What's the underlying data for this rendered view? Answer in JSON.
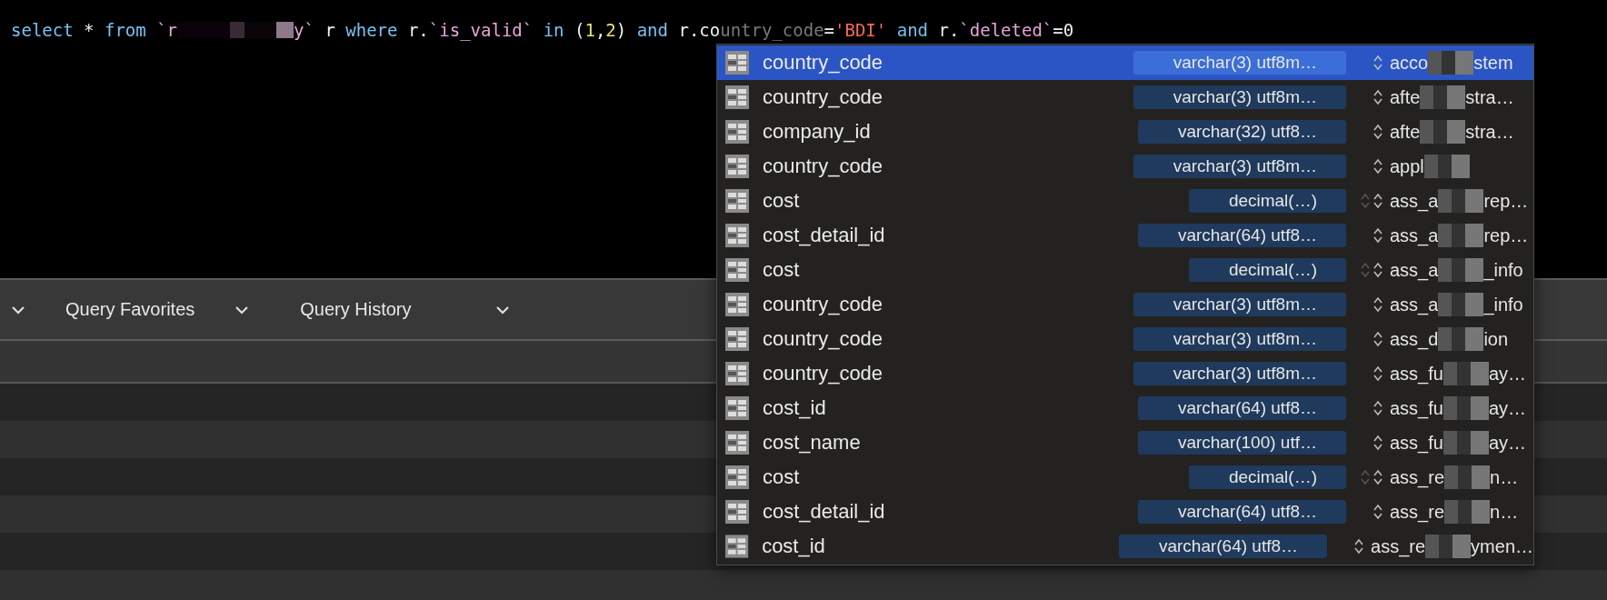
{
  "editor": {
    "tokens": [
      {
        "kind": "keyword",
        "text": "select"
      },
      {
        "kind": "plain",
        "text": " * "
      },
      {
        "kind": "keyword",
        "text": "from "
      },
      {
        "kind": "ident",
        "text": "`r"
      },
      {
        "kind": "redacted"
      },
      {
        "kind": "ident",
        "text": "y`"
      },
      {
        "kind": "plain",
        "text": " r "
      },
      {
        "kind": "keyword",
        "text": "where"
      },
      {
        "kind": "plain",
        "text": " r."
      },
      {
        "kind": "ident",
        "text": "`is_valid`"
      },
      {
        "kind": "keyword",
        "text": " in"
      },
      {
        "kind": "plain",
        "text": " ("
      },
      {
        "kind": "number",
        "text": "1"
      },
      {
        "kind": "plain",
        "text": ","
      },
      {
        "kind": "number",
        "text": "2"
      },
      {
        "kind": "plain",
        "text": ") "
      },
      {
        "kind": "keyword",
        "text": "and"
      },
      {
        "kind": "plain",
        "text": " r.co"
      },
      {
        "kind": "ghost",
        "text": "untry_code"
      },
      {
        "kind": "plain",
        "text": "="
      },
      {
        "kind": "string",
        "text": "'BDI'"
      },
      {
        "kind": "keyword",
        "text": " and"
      },
      {
        "kind": "plain",
        "text": " r."
      },
      {
        "kind": "ident",
        "text": "`deleted`"
      },
      {
        "kind": "plain",
        "text": "=0"
      }
    ]
  },
  "toolbar": {
    "items": [
      {
        "label": "Query Favorites"
      },
      {
        "label": "Query History"
      }
    ]
  },
  "completions": [
    {
      "name": "country_code",
      "type": "varchar(3) utf8m…",
      "table_start": "acco",
      "table_end": "stem",
      "selected": true,
      "dual_chevron": false
    },
    {
      "name": "country_code",
      "type": "varchar(3) utf8m…",
      "table_start": "afte",
      "table_end": "stra…",
      "selected": false,
      "dual_chevron": false
    },
    {
      "name": "company_id",
      "type": "varchar(32) utf8…",
      "table_start": "afte",
      "table_end": "stra…",
      "selected": false,
      "dual_chevron": false
    },
    {
      "name": "country_code",
      "type": "varchar(3) utf8m…",
      "table_start": "appl",
      "selected": false,
      "dual_chevron": false
    },
    {
      "name": "cost",
      "type": "decimal(…)",
      "table_start": "ass_a",
      "table_end": "rep…",
      "selected": false,
      "dual_chevron": true
    },
    {
      "name": "cost_detail_id",
      "type": "varchar(64) utf8…",
      "table_start": "ass_a",
      "table_end": "rep…",
      "selected": false,
      "dual_chevron": false
    },
    {
      "name": "cost",
      "type": "decimal(…)",
      "table_start": "ass_a",
      "table_end": "_info",
      "selected": false,
      "dual_chevron": true
    },
    {
      "name": "country_code",
      "type": "varchar(3) utf8m…",
      "table_start": "ass_a",
      "table_end": "_info",
      "selected": false,
      "dual_chevron": false
    },
    {
      "name": "country_code",
      "type": "varchar(3) utf8m…",
      "table_start": "ass_d",
      "table_end": "ion",
      "selected": false,
      "dual_chevron": false
    },
    {
      "name": "country_code",
      "type": "varchar(3) utf8m…",
      "table_start": "ass_fu",
      "table_end": "ay…",
      "selected": false,
      "dual_chevron": false
    },
    {
      "name": "cost_id",
      "type": "varchar(64) utf8…",
      "table_start": "ass_fu",
      "table_end": "ay…",
      "selected": false,
      "dual_chevron": false
    },
    {
      "name": "cost_name",
      "type": "varchar(100) utf…",
      "table_start": "ass_fu",
      "table_end": "ay…",
      "selected": false,
      "dual_chevron": false
    },
    {
      "name": "cost",
      "type": "decimal(…)",
      "table_start": "ass_re",
      "table_end": "n…",
      "selected": false,
      "dual_chevron": true
    },
    {
      "name": "cost_detail_id",
      "type": "varchar(64) utf8…",
      "table_start": "ass_re",
      "table_end": "n…",
      "selected": false,
      "dual_chevron": false
    },
    {
      "name": "cost_id",
      "type": "varchar(64) utf8…",
      "table_start": "ass_re",
      "table_end": "ymen…",
      "selected": false,
      "dual_chevron": false
    }
  ]
}
